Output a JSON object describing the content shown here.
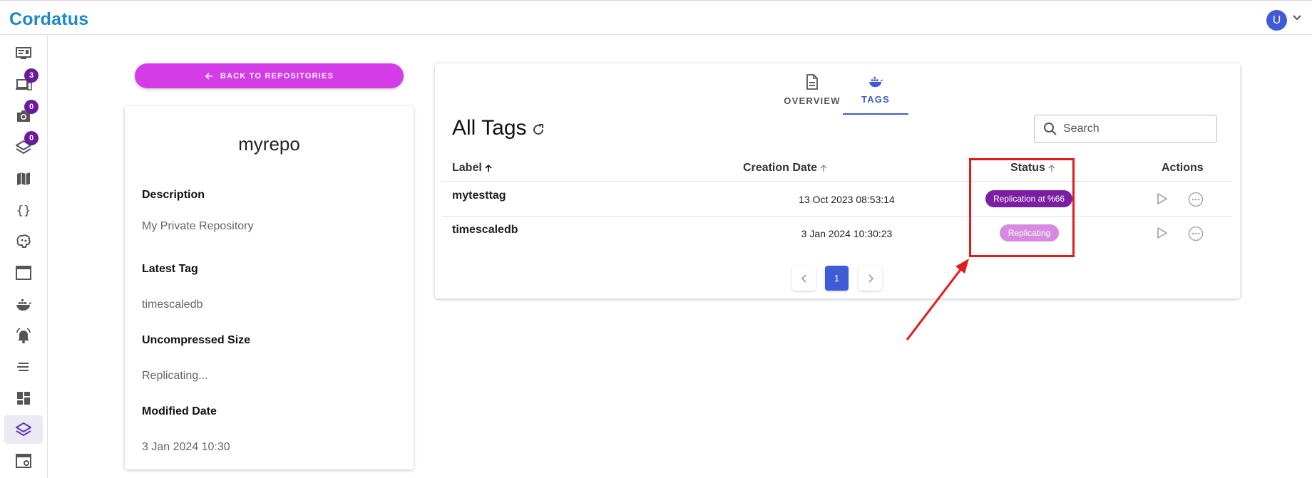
{
  "app": {
    "logo": "Cordatus"
  },
  "user": {
    "initial": "U"
  },
  "colors": {
    "accent": "#3f5bd6",
    "brand": "#1e88c7",
    "back_button": "#d43ce8",
    "badge": "#6a1b9a",
    "status_replication": "#7b1fa2",
    "status_replicating": "#d68be0",
    "annotation": "#e21b1b"
  },
  "sidebar": {
    "items": [
      {
        "icon": "monitor-icon"
      },
      {
        "icon": "devices-icon",
        "badge": "3"
      },
      {
        "icon": "camera-icon",
        "badge": "0"
      },
      {
        "icon": "layers-icon",
        "badge": "0"
      },
      {
        "icon": "map-icon"
      },
      {
        "icon": "code-braces-icon"
      },
      {
        "icon": "brain-icon"
      },
      {
        "icon": "window-icon"
      },
      {
        "icon": "docker-icon"
      },
      {
        "icon": "alarm-bell-icon"
      },
      {
        "icon": "text-lines-icon"
      },
      {
        "icon": "dashboard-icon"
      },
      {
        "icon": "layers-icon",
        "active": true
      },
      {
        "icon": "window-settings-icon"
      }
    ]
  },
  "repo": {
    "back_label": "BACK TO REPOSITORIES",
    "name": "myrepo",
    "description_label": "Description",
    "description": "My Private Repository",
    "latest_tag_label": "Latest Tag",
    "latest_tag": "timescaledb",
    "size_label": "Uncompressed Size",
    "size": "Replicating...",
    "modified_label": "Modified Date",
    "modified": "3 Jan 2024 10:30"
  },
  "tabs": [
    {
      "label": "OVERVIEW",
      "icon": "document-icon"
    },
    {
      "label": "TAGS",
      "icon": "docker-icon",
      "active": true
    }
  ],
  "tags": {
    "title": "All Tags",
    "search_placeholder": "Search",
    "columns": {
      "label": "Label",
      "date": "Creation Date",
      "status": "Status",
      "actions": "Actions"
    },
    "rows": [
      {
        "label": "mytesttag",
        "date": "13 Oct 2023 08:53:14",
        "status": "Replication at %66"
      },
      {
        "label": "timescaledb",
        "date": "3 Jan 2024 10:30:23",
        "status": "Replicating"
      }
    ],
    "page": "1"
  }
}
